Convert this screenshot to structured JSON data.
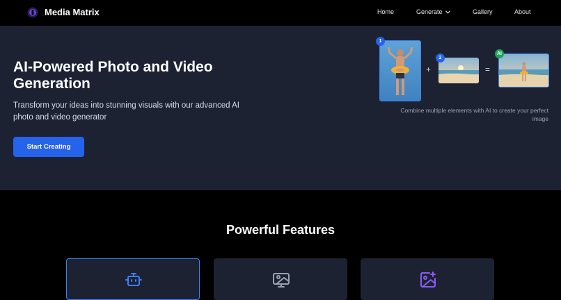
{
  "nav": {
    "brand": "Media Matrix",
    "logo_icon": "logo-icon",
    "items": [
      {
        "label": "Home"
      },
      {
        "label": "Generate",
        "icon": "chevron-down-icon"
      },
      {
        "label": "Gallery"
      },
      {
        "label": "About"
      }
    ]
  },
  "hero": {
    "title": "AI-Powered Photo and Video Generation",
    "subtitle": "Transform your ideas into stunning visuals with our advanced AI photo and video generator",
    "cta_label": "Start Creating",
    "combo": {
      "badges": [
        "1",
        "2",
        "AI"
      ],
      "plus": "+",
      "equals": "=",
      "caption": "Combine multiple elements with AI to create your perfect image"
    }
  },
  "features": {
    "title": "Powerful Features",
    "cards": [
      {
        "icon": "robot-icon"
      },
      {
        "icon": "monitor-image-icon"
      },
      {
        "icon": "image-plus-icon"
      }
    ]
  },
  "colors": {
    "accent": "#2563eb",
    "hero_bg": "#1d2233",
    "page_bg": "#000000",
    "ai_badge": "#22a35a"
  }
}
